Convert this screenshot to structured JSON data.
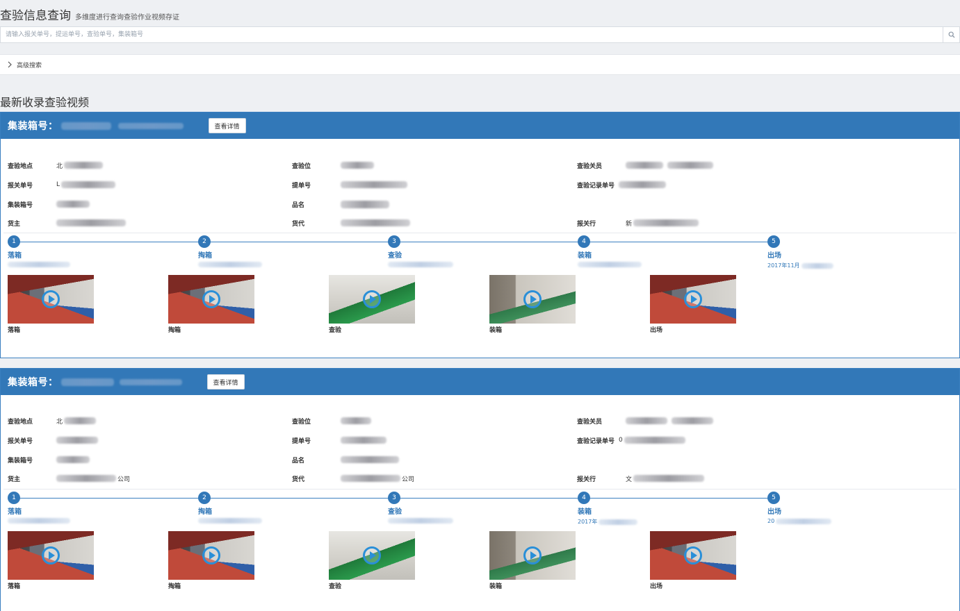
{
  "header": {
    "title": "查验信息查询",
    "subtitle": "多维度进行查询查验作业视频存证"
  },
  "search": {
    "placeholder": "请输入报关单号，提运单号，查验单号，集装箱号",
    "icon": "search-icon"
  },
  "advanced": {
    "label": "高级搜索",
    "icon": "chevron-right-icon"
  },
  "section": {
    "title": "最新收录查验视频"
  },
  "labels": {
    "container_prefix": "集装箱号：",
    "detail_button": "查看详情",
    "location": "查验地点",
    "position": "查验位",
    "officer": "查验关员",
    "declaration_no": "报关单号",
    "bill_no": "提单号",
    "record_no": "查验记录单号",
    "container_no": "集装箱号",
    "product": "品名",
    "owner": "货主",
    "forwarder": "货代",
    "broker": "报关行"
  },
  "steps": [
    {
      "num": "1",
      "label": "落箱"
    },
    {
      "num": "2",
      "label": "掏箱"
    },
    {
      "num": "3",
      "label": "查验"
    },
    {
      "num": "4",
      "label": "装箱"
    },
    {
      "num": "5",
      "label": "出场"
    }
  ],
  "records": [
    {
      "location_prefix": "北",
      "declaration_prefix": "L",
      "broker_prefix": "新",
      "step5_time": "2017年11月",
      "videos": [
        {
          "label": "落箱",
          "scene": "stack"
        },
        {
          "label": "掏箱",
          "scene": "stack"
        },
        {
          "label": "查验",
          "scene": "green"
        },
        {
          "label": "装箱",
          "scene": "yard"
        },
        {
          "label": "出场",
          "scene": "stack"
        }
      ]
    },
    {
      "location_prefix": "北",
      "record_prefix": "0",
      "owner_suffix": "公司",
      "forwarder_suffix": "公司",
      "broker_prefix": "文",
      "step4_time": "2017年",
      "step5_time": "20",
      "videos": [
        {
          "label": "落箱",
          "scene": "stack"
        },
        {
          "label": "掏箱",
          "scene": "stack"
        },
        {
          "label": "查验",
          "scene": "green"
        },
        {
          "label": "装箱",
          "scene": "yard"
        },
        {
          "label": "出场",
          "scene": "stack"
        }
      ]
    }
  ],
  "colors": {
    "primary": "#3278b8",
    "play": "#2a8fd8",
    "background": "#eef0f3"
  }
}
